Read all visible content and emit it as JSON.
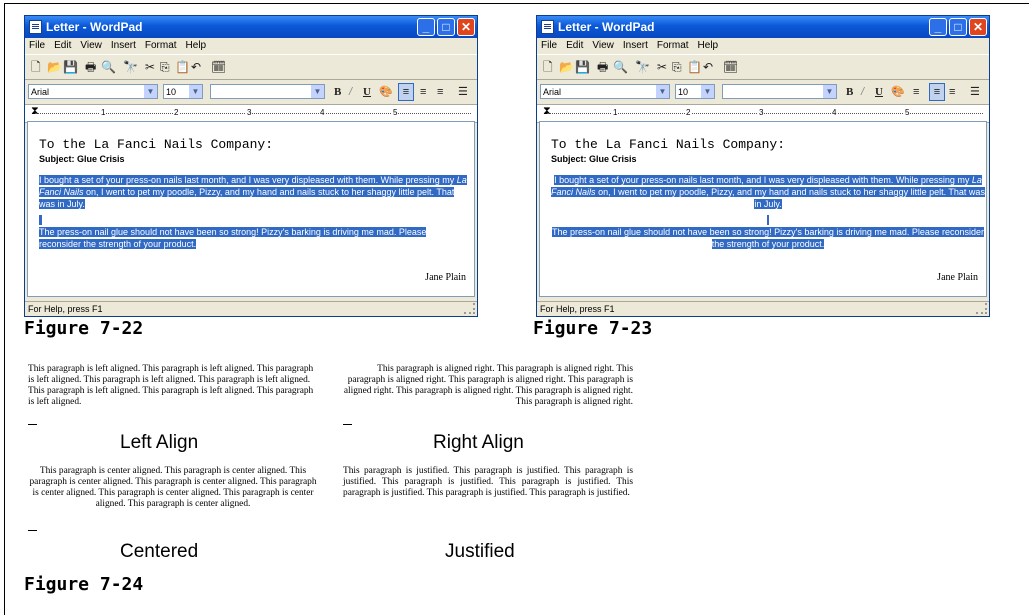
{
  "window": {
    "title": "Letter - WordPad",
    "menu": [
      "File",
      "Edit",
      "View",
      "Insert",
      "Format",
      "Help"
    ],
    "font_name": "Arial",
    "font_size": "10",
    "ruler_numbers": [
      "1",
      "2",
      "3",
      "4",
      "5"
    ],
    "status": "For Help, press F1"
  },
  "letter": {
    "greeting": "To the La Fanci Nails Company:",
    "subject": "Subject: Glue Crisis",
    "para1_a": "I bought a set of your press-on nails last month, and I was very displeased with them. While pressing my ",
    "para1_em": "La Fanci Nails",
    "para1_b": " on, I went to pet my poodle, Pizzy, and my hand and nails stuck to her shaggy little pelt. That was in July.",
    "para2": "The press-on nail glue should not have been so strong! Pizzy's barking is driving me mad. Please reconsider the strength of your product.",
    "signature": "Jane Plain"
  },
  "figures": {
    "fig1": "Figure 7-22",
    "fig2": "Figure 7-23",
    "fig3": "Figure 7-24"
  },
  "samples": {
    "left_text": "This paragraph is left aligned. This paragraph is left aligned. This paragraph is left aligned. This paragraph is left aligned. This paragraph is left aligned. This paragraph is left aligned. This paragraph is left aligned. This paragraph is left aligned.",
    "left_caption": "Left Align",
    "right_text": "This paragraph is aligned right. This paragraph is aligned right. This paragraph is aligned right. This paragraph is aligned right. This paragraph is aligned right. This paragraph is aligned right. This paragraph is aligned right. This paragraph is aligned right.",
    "right_caption": "Right Align",
    "center_text": "This paragraph is center aligned. This paragraph is center aligned. This paragraph is center aligned. This paragraph is center aligned. This paragraph is center aligned. This paragraph is center aligned. This paragraph is center aligned. This paragraph is center aligned.",
    "center_caption": "Centered",
    "justify_text": "This paragraph is justified. This paragraph is justified. This paragraph is justified. This paragraph is justified. This paragraph is justified. This paragraph is justified. This paragraph is justified. This paragraph is justified.",
    "justify_caption": "Justified"
  },
  "colors": {
    "titlebar": "#0a58d8",
    "selection": "#316ac5",
    "close_button": "#e0451e"
  },
  "icons": [
    "app-icon",
    "minimize-icon",
    "maximize-icon",
    "close-icon",
    "new-icon",
    "open-icon",
    "save-icon",
    "print-icon",
    "print-preview-icon",
    "find-icon",
    "cut-icon",
    "copy-icon",
    "paste-icon",
    "undo-icon",
    "date-time-icon",
    "bold-icon",
    "italic-icon",
    "underline-icon",
    "color-icon",
    "align-left-icon",
    "align-center-icon",
    "align-right-icon",
    "bullets-icon"
  ]
}
